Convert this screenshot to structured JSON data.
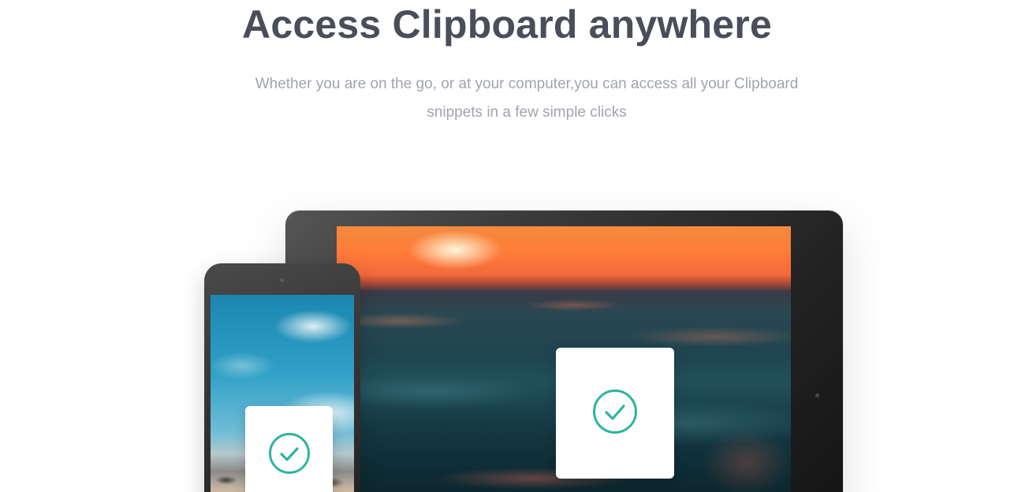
{
  "hero": {
    "title": "Access Clipboard anywhere",
    "subtitle_line1": "Whether you are on the go, or at your computer,you can access all your Clipboard",
    "subtitle_line2": "snippets in a few simple clicks"
  },
  "devices": {
    "tablet": {
      "screen": "sunset-ocean-photo",
      "card_icon": "check-circle-icon"
    },
    "phone": {
      "screen": "beach-sky-photo",
      "card_icon": "check-circle-icon"
    }
  },
  "colors": {
    "heading": "#4a4e5a",
    "subtext": "#a0a4ac",
    "check_accent": "#2bb5a0"
  }
}
